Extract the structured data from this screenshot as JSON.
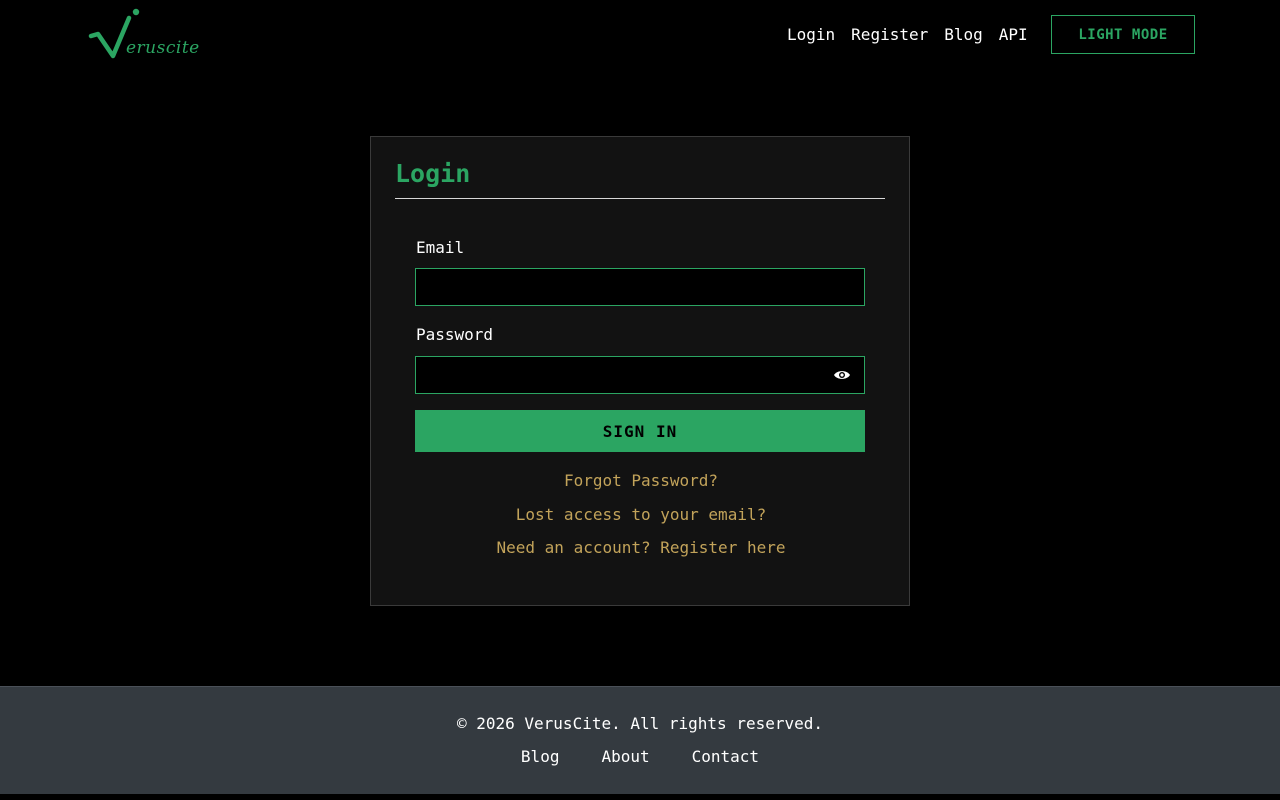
{
  "brand": {
    "name": "eruscite",
    "accent_color": "#2ba562"
  },
  "nav": {
    "items": [
      {
        "label": "Login"
      },
      {
        "label": "Register"
      },
      {
        "label": "Blog"
      },
      {
        "label": "API"
      }
    ],
    "mode_button": "LIGHT MODE"
  },
  "login": {
    "title": "Login",
    "email_label": "Email",
    "email_value": "",
    "password_label": "Password",
    "password_value": "",
    "password_toggle_icon": "eye-icon",
    "submit_label": "SIGN IN",
    "forgot_link": "Forgot Password?",
    "lost_email_link": "Lost access to your email?",
    "register_link": "Need an account? Register here",
    "link_color": "#c2a35a"
  },
  "footer": {
    "copyright": "© 2026 VerusCite. All rights reserved.",
    "links": [
      {
        "label": "Blog"
      },
      {
        "label": "About"
      },
      {
        "label": "Contact"
      }
    ],
    "background": "#343a40"
  }
}
